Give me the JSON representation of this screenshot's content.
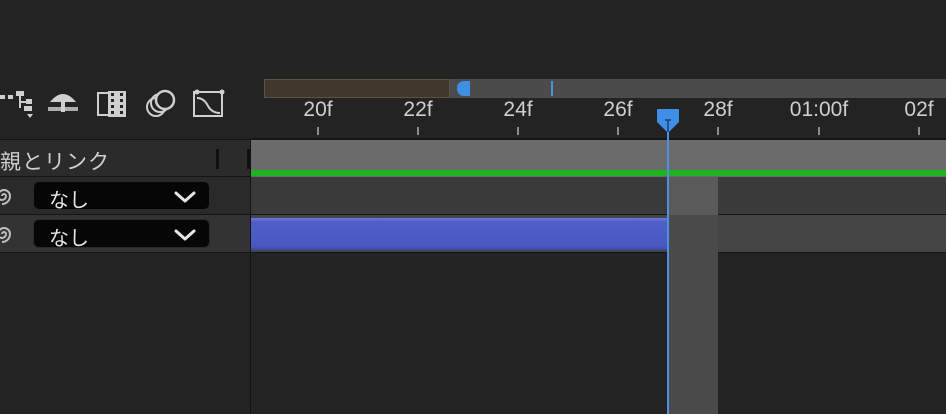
{
  "toolbar": {
    "icons": [
      "hierarchy-icon",
      "shy-layers-icon",
      "frame-blending-icon",
      "motion-blur-icon",
      "graph-editor-icon"
    ]
  },
  "columns": {
    "parent_link_label": "親とリンク"
  },
  "layers": [
    {
      "parent_value": "なし"
    },
    {
      "parent_value": "なし"
    }
  ],
  "ruler": {
    "labels": [
      "20f",
      "22f",
      "24f",
      "26f",
      "28f",
      "01:00f",
      "02f"
    ]
  },
  "colors": {
    "playhead": "#4a90e8",
    "work_area_line": "#1fb31f",
    "layer_bar": "#4f5fc7"
  }
}
